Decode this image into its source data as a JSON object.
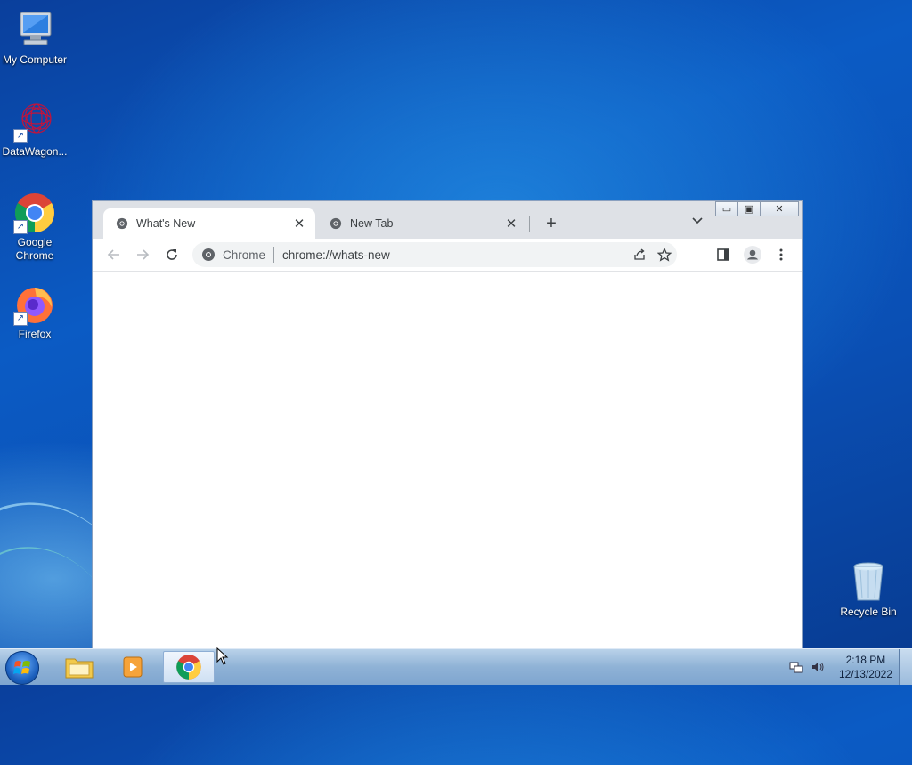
{
  "desktop": {
    "icons": [
      {
        "label": "My Computer"
      },
      {
        "label": "DataWagon..."
      },
      {
        "label": "Google Chrome"
      },
      {
        "label": "Firefox"
      },
      {
        "label": "Recycle Bin"
      }
    ]
  },
  "browser": {
    "tabs": [
      {
        "title": "What's New",
        "active": true
      },
      {
        "title": "New Tab",
        "active": false
      }
    ],
    "new_tab_symbol": "+",
    "caption_buttons": {
      "minimize": "▭",
      "maximize": "▣",
      "close": "✕"
    },
    "address_bar": {
      "site_label": "Chrome",
      "url": "chrome://whats-new"
    }
  },
  "taskbar": {
    "clock_time": "2:18 PM",
    "clock_date": "12/13/2022"
  },
  "colors": {
    "chrome_tabstrip": "#dee1e6",
    "chrome_toolbar": "#ffffff",
    "omnibox_bg": "#f1f3f4",
    "desktop_blue": "#0b5bc4"
  },
  "icons": {
    "back": "arrow-left-icon",
    "forward": "arrow-right-icon",
    "reload": "reload-icon",
    "share": "share-icon",
    "bookmark": "star-icon",
    "side_panel": "side-panel-icon",
    "profile": "profile-icon",
    "menu": "kebab-menu-icon"
  }
}
